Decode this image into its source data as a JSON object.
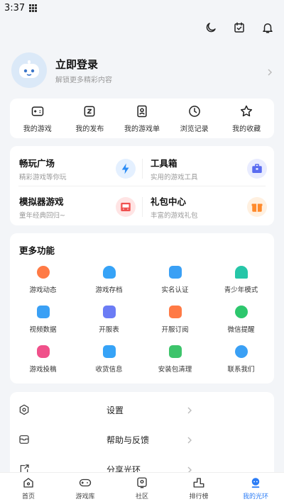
{
  "status": {
    "time": "3:37"
  },
  "profile": {
    "title": "立即登录",
    "subtitle": "解锁更多精彩内容"
  },
  "quick": [
    {
      "label": "我的游戏",
      "icon": "gamepad-icon"
    },
    {
      "label": "我的发布",
      "icon": "publish-icon"
    },
    {
      "label": "我的游戏单",
      "icon": "gamelist-icon"
    },
    {
      "label": "浏览记录",
      "icon": "history-icon"
    },
    {
      "label": "我的收藏",
      "icon": "star-icon"
    }
  ],
  "features": [
    {
      "name": "畅玩广场",
      "sub": "精彩游戏等你玩",
      "icon": "lightning-icon",
      "color": "#e4f0ff"
    },
    {
      "name": "工具箱",
      "sub": "实用的游戏工具",
      "icon": "toolbox-icon",
      "color": "#e9ecff"
    },
    {
      "name": "模拟器游戏",
      "sub": "童年经典回归~",
      "icon": "emulator-icon",
      "color": "#ffe4e4"
    },
    {
      "name": "礼包中心",
      "sub": "丰富的游戏礼包",
      "icon": "gift-icon",
      "color": "#fff0e0"
    }
  ],
  "more": {
    "title": "更多功能",
    "items": [
      {
        "label": "游戏动态",
        "icon": "dynamic-icon",
        "color": "#ff7a45"
      },
      {
        "label": "游戏存档",
        "icon": "cloud-save-icon",
        "color": "#36a3f7"
      },
      {
        "label": "实名认证",
        "icon": "id-card-icon",
        "color": "#3aa0f5"
      },
      {
        "label": "青少年模式",
        "icon": "umbrella-icon",
        "color": "#26c6a8"
      },
      {
        "label": "视频数据",
        "icon": "video-data-icon",
        "color": "#3aa0f5"
      },
      {
        "label": "开服表",
        "icon": "server-list-icon",
        "color": "#6b7cf5"
      },
      {
        "label": "开服订阅",
        "icon": "calendar-icon",
        "color": "#ff7a45"
      },
      {
        "label": "微信提醒",
        "icon": "wechat-icon",
        "color": "#2dc76d"
      },
      {
        "label": "游戏投稿",
        "icon": "submit-icon",
        "color": "#f0508a"
      },
      {
        "label": "收货信息",
        "icon": "address-icon",
        "color": "#36a3f7"
      },
      {
        "label": "安装包清理",
        "icon": "clean-icon",
        "color": "#3dc46b"
      },
      {
        "label": "联系我们",
        "icon": "service-icon",
        "color": "#3aa0f5"
      }
    ]
  },
  "settings": [
    {
      "label": "设置",
      "icon": "settings-icon"
    },
    {
      "label": "帮助与反馈",
      "icon": "help-icon"
    },
    {
      "label": "分享光环",
      "icon": "share-icon"
    }
  ],
  "tabs": [
    {
      "label": "首页",
      "icon": "home-icon"
    },
    {
      "label": "游戏库",
      "icon": "game-library-icon"
    },
    {
      "label": "社区",
      "icon": "community-icon"
    },
    {
      "label": "排行榜",
      "icon": "ranking-icon"
    },
    {
      "label": "我的光环",
      "icon": "profile-icon",
      "active": true
    }
  ],
  "colors": {
    "accent": "#2b7cf6",
    "background": "#f3f5f8"
  }
}
